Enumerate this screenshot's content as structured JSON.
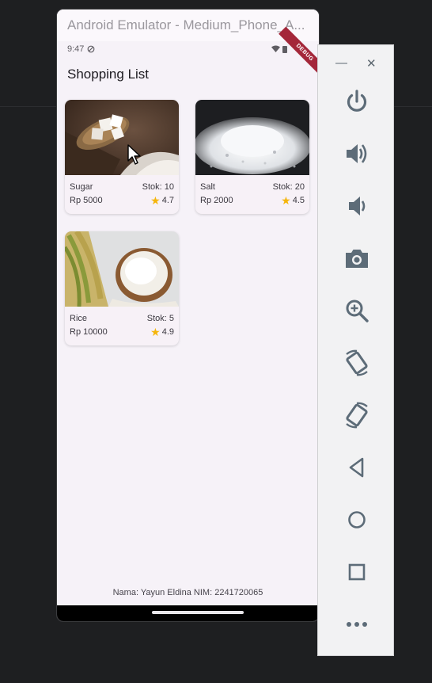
{
  "emulator": {
    "title": "Android Emulator - Medium_Phone_A..."
  },
  "status_bar": {
    "time": "9:47",
    "debug_label": "DEBUG"
  },
  "app": {
    "title": "Shopping List",
    "products": [
      {
        "name": "Sugar",
        "price": "Rp 5000",
        "stock": "Stok: 10",
        "rating": "4.7"
      },
      {
        "name": "Salt",
        "price": "Rp 2000",
        "stock": "Stok: 20",
        "rating": "4.5"
      },
      {
        "name": "Rice",
        "price": "Rp 10000",
        "stock": "Stok: 5",
        "rating": "4.9"
      }
    ],
    "footer": "Nama: Yayun Eldina NIM: 2241720065"
  },
  "toolbar": {
    "minimize_label": "—",
    "close_label": "✕",
    "buttons": [
      {
        "icon": "power-icon"
      },
      {
        "icon": "volume-up-icon"
      },
      {
        "icon": "volume-down-icon"
      },
      {
        "icon": "camera-icon"
      },
      {
        "icon": "zoom-in-icon"
      },
      {
        "icon": "rotate-left-icon"
      },
      {
        "icon": "rotate-right-icon"
      },
      {
        "icon": "back-icon"
      },
      {
        "icon": "home-icon"
      },
      {
        "icon": "overview-icon"
      },
      {
        "icon": "more-icon"
      }
    ]
  },
  "colors": {
    "icon": "#5d6c78",
    "star": "#f5b50a",
    "debug_ribbon": "#a4273a"
  }
}
